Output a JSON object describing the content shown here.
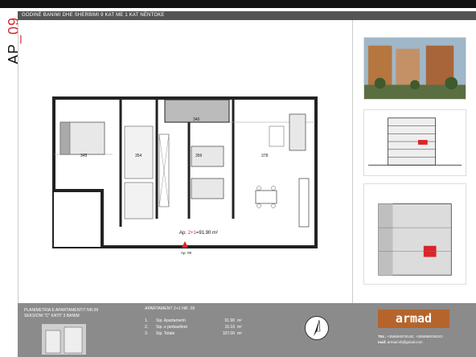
{
  "page": {
    "header_title": "GODINË BANIMI DHE SHERBIMI 9 KAT ME 1 KAT NËNTOKE",
    "apartment_code": "AP_09",
    "apartment_code_prefix": "AP",
    "apartment_code_suffix": "_09"
  },
  "plan": {
    "dims": [
      "345",
      "354",
      "356",
      "378",
      "340"
    ],
    "apartment_tag_prefix": "Ap.",
    "apartment_tag_type": "2+1",
    "apartment_tag_rest": "=91.90 m²",
    "entrance_label": "Ap. 09"
  },
  "footer": {
    "left_line1": "PLANIMETRIA E APARTAMENTIT NR.09",
    "left_line2": "SEKSIONI \"C\" KATIT 3 BANIM",
    "mid_title": "APARTAMENT 2+1 NR. 09",
    "rows": [
      {
        "n": "1.",
        "label": "Sip. Apartamenti",
        "value": "91.90",
        "unit": "m²"
      },
      {
        "n": "2.",
        "label": "Sip. e perbashket",
        "value": "15.16",
        "unit": "m²"
      },
      {
        "n": "3.",
        "label": "Sip. Totale",
        "value": "107.06",
        "unit": "m²"
      }
    ],
    "logo_text": "armad",
    "tel_label": "TEL:",
    "tel_value": "+35569407814E; +35569603501O",
    "mail_label": "mail:",
    "mail_value": "armad.sh@gmail.com"
  },
  "colors": {
    "brand": "#b5652c",
    "accent_red": "#d8262b",
    "footer_bg": "#8b8b8b",
    "title_bg": "#555555"
  }
}
